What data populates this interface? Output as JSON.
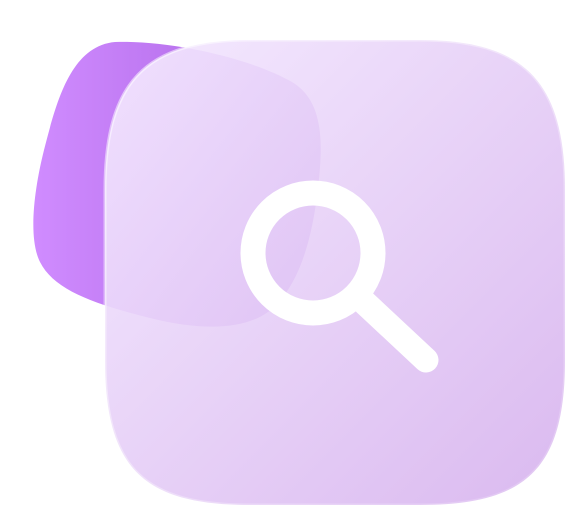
{
  "icon": {
    "name": "search-icon",
    "accessible_label": ""
  },
  "colors": {
    "background": "#ffffff",
    "back_tile_start": "#d08cff",
    "back_tile_end": "#a75ee0",
    "front_tile_start": "#f3e6ff",
    "front_tile_end": "#d9b9ef",
    "glyph": "#ffffff"
  }
}
